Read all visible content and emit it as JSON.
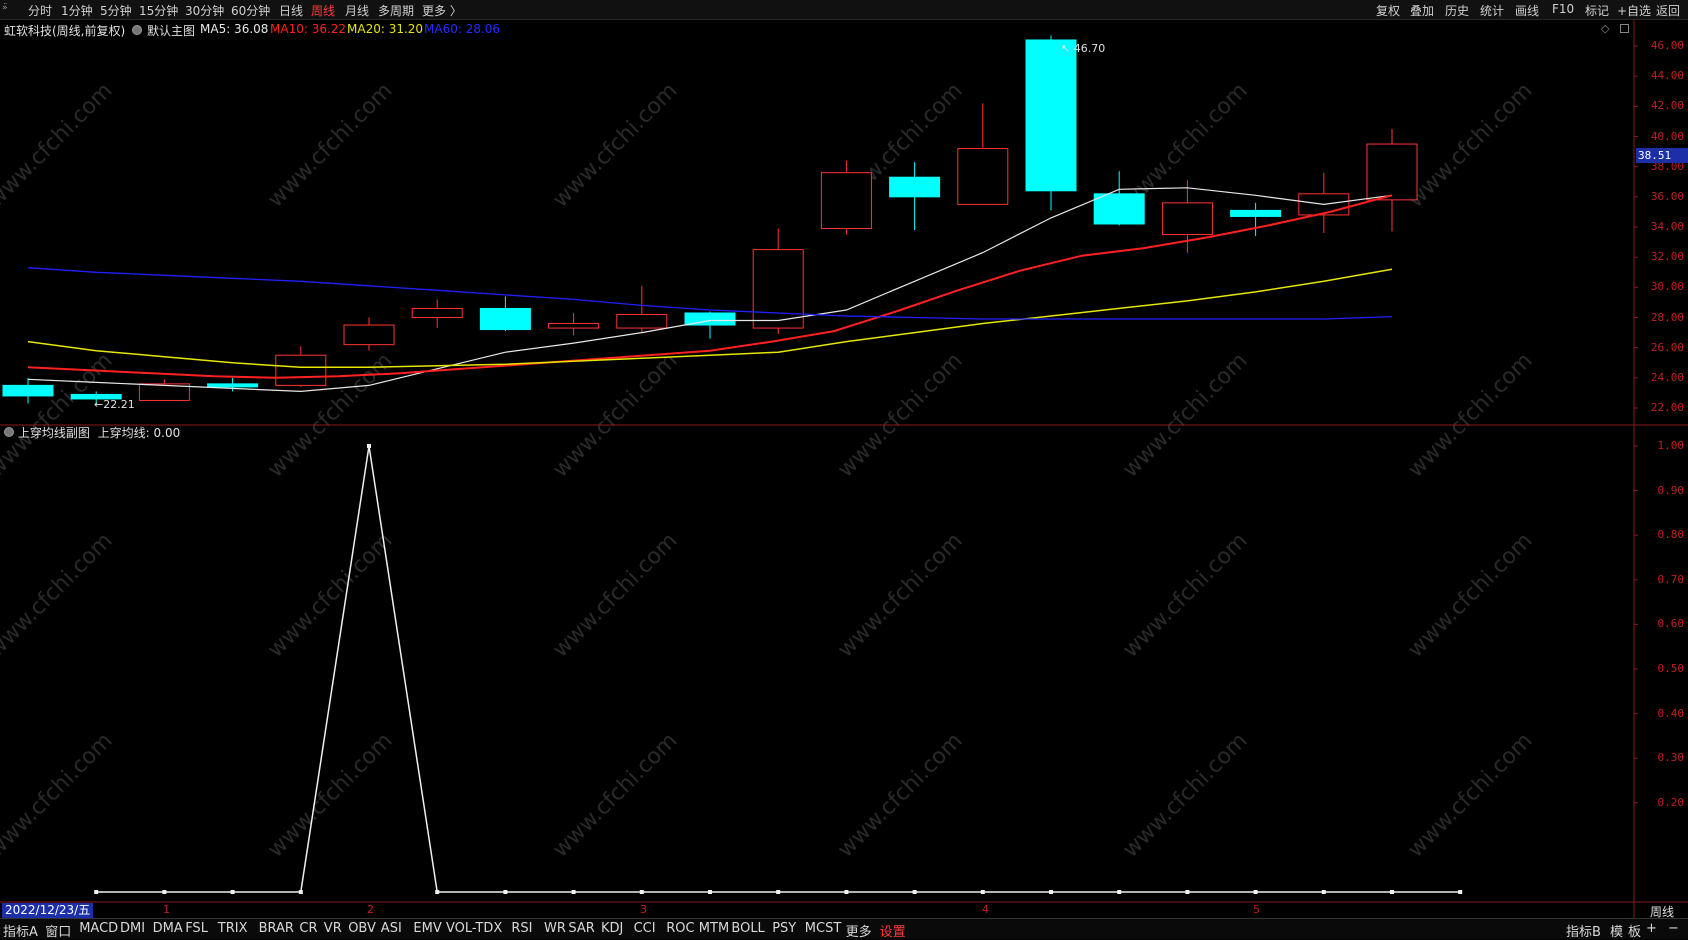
{
  "toolbar": {
    "periods": [
      "分时",
      "1分钟",
      "5分钟",
      "15分钟",
      "30分钟",
      "60分钟",
      "日线",
      "周线",
      "月线",
      "多周期",
      "更多 〉"
    ],
    "active_period": "周线",
    "right_items": [
      "复权",
      "叠加",
      "历史",
      "统计",
      "画线",
      "F10",
      "标记",
      "+自选",
      "返回"
    ]
  },
  "main_chart_header": {
    "stock_title": "虹软科技(周线,前复权)",
    "template_label": "默认主图",
    "ma5": "MA5: 36.08",
    "ma10": "MA10: 36.22",
    "ma20": "MA20: 31.20",
    "ma60": "MA60: 28.06"
  },
  "sub_chart_header": {
    "title": "上穿均线副图",
    "value": "上穿均线: 0.00"
  },
  "annotations": {
    "high_label": "46.70",
    "low_label": "←22.21",
    "current_price": "38.51"
  },
  "date_label": "2022/12/23/五",
  "period_badge": "周线",
  "month_markers": [
    "1",
    "2",
    "3",
    "4",
    "5"
  ],
  "bottom_tabs": [
    "指标A",
    "窗口",
    "MACD",
    "DMI",
    "DMA",
    "FSL",
    "TRIX",
    "BRAR",
    "CR",
    "VR",
    "OBV",
    "ASI",
    "EMV",
    "VOL-TDX",
    "RSI",
    "WR",
    "SAR",
    "KDJ",
    "CCI",
    "ROC",
    "MTM",
    "BOLL",
    "PSY",
    "MCST",
    "更多",
    "设置"
  ],
  "bottom_right": [
    "指标B",
    "模",
    "板",
    "+",
    "−"
  ],
  "watermark": "www.cfchi.com",
  "colors": {
    "up": "#ff3333",
    "down": "#00ffff",
    "ma5": "#e8e8e8",
    "ma10": "#ff2020",
    "ma20": "#e6e600",
    "ma60": "#2020ff",
    "axis": "#c02020"
  },
  "chart_data": [
    {
      "type": "candlestick",
      "title": "虹软科技(周线,前复权)",
      "ylim": [
        21,
        48
      ],
      "yticks": [
        "22.00",
        "24.00",
        "26.00",
        "28.00",
        "30.00",
        "32.00",
        "34.00",
        "36.00",
        "38.00",
        "40.00",
        "42.00",
        "44.00",
        "46.00"
      ],
      "candles": [
        {
          "o": 23.5,
          "c": 22.8,
          "h": 24.0,
          "l": 22.3
        },
        {
          "o": 22.9,
          "c": 22.6,
          "h": 23.1,
          "l": 22.21
        },
        {
          "o": 22.5,
          "c": 23.6,
          "h": 23.9,
          "l": 22.5
        },
        {
          "o": 23.6,
          "c": 23.4,
          "h": 24.0,
          "l": 23.1
        },
        {
          "o": 23.5,
          "c": 25.5,
          "h": 26.1,
          "l": 23.4
        },
        {
          "o": 26.2,
          "c": 27.5,
          "h": 28.0,
          "l": 25.8
        },
        {
          "o": 28.0,
          "c": 28.6,
          "h": 29.2,
          "l": 27.3
        },
        {
          "o": 28.6,
          "c": 27.2,
          "h": 29.4,
          "l": 27.1
        },
        {
          "o": 27.3,
          "c": 27.6,
          "h": 28.3,
          "l": 26.8
        },
        {
          "o": 27.3,
          "c": 28.2,
          "h": 30.1,
          "l": 27.0
        },
        {
          "o": 28.3,
          "c": 27.5,
          "h": 28.4,
          "l": 26.6
        },
        {
          "o": 27.3,
          "c": 32.5,
          "h": 33.9,
          "l": 26.9
        },
        {
          "o": 33.9,
          "c": 37.6,
          "h": 38.4,
          "l": 33.5
        },
        {
          "o": 37.3,
          "c": 36.0,
          "h": 38.3,
          "l": 33.8
        },
        {
          "o": 35.5,
          "c": 39.2,
          "h": 42.2,
          "l": 35.5
        },
        {
          "o": 46.4,
          "c": 36.4,
          "h": 46.7,
          "l": 35.1
        },
        {
          "o": 36.2,
          "c": 34.2,
          "h": 37.7,
          "l": 34.1
        },
        {
          "o": 33.5,
          "c": 35.6,
          "h": 37.1,
          "l": 32.3
        },
        {
          "o": 35.1,
          "c": 34.7,
          "h": 35.6,
          "l": 33.4
        },
        {
          "o": 34.8,
          "c": 36.2,
          "h": 37.6,
          "l": 33.6
        },
        {
          "o": 35.8,
          "c": 39.5,
          "h": 40.5,
          "l": 33.7
        }
      ],
      "series": [
        {
          "name": "MA5",
          "values": [
            23.9,
            23.7,
            23.5,
            23.3,
            23.1,
            23.5,
            24.6,
            25.7,
            26.3,
            27.0,
            27.8,
            27.8,
            28.5,
            30.4,
            32.3,
            34.6,
            36.5,
            36.6,
            36.1,
            35.5,
            36.1
          ]
        },
        {
          "name": "MA10",
          "values": [
            24.7,
            24.5,
            24.3,
            24.1,
            24.0,
            24.1,
            24.3,
            24.6,
            24.9,
            25.2,
            25.5,
            25.8,
            26.4,
            27.1,
            28.4,
            29.8,
            31.1,
            32.1,
            32.6,
            33.3,
            34.1,
            35.0,
            36.1
          ]
        },
        {
          "name": "MA20",
          "values": [
            26.4,
            25.8,
            25.4,
            25.0,
            24.7,
            24.7,
            24.8,
            24.9,
            25.1,
            25.3,
            25.5,
            25.7,
            26.4,
            27.0,
            27.6,
            28.1,
            28.6,
            29.1,
            29.7,
            30.4,
            31.2
          ]
        },
        {
          "name": "MA60",
          "values": [
            31.3,
            31.0,
            30.8,
            30.6,
            30.4,
            30.1,
            29.8,
            29.5,
            29.2,
            28.8,
            28.5,
            28.3,
            28.1,
            28.0,
            27.9,
            27.9,
            27.9,
            27.9,
            27.9,
            27.9,
            28.06
          ]
        }
      ]
    },
    {
      "type": "line",
      "title": "上穿均线副图",
      "ylim": [
        0,
        1.05
      ],
      "yticks": [
        "0.20",
        "0.30",
        "0.40",
        "0.50",
        "0.60",
        "0.70",
        "0.80",
        "0.90",
        "1.00"
      ],
      "series": [
        {
          "name": "上穿均线",
          "values": [
            0,
            0,
            0,
            0,
            1,
            0,
            0,
            0,
            0,
            0,
            0,
            0,
            0,
            0,
            0,
            0,
            0,
            0,
            0,
            0,
            0
          ]
        }
      ]
    }
  ]
}
